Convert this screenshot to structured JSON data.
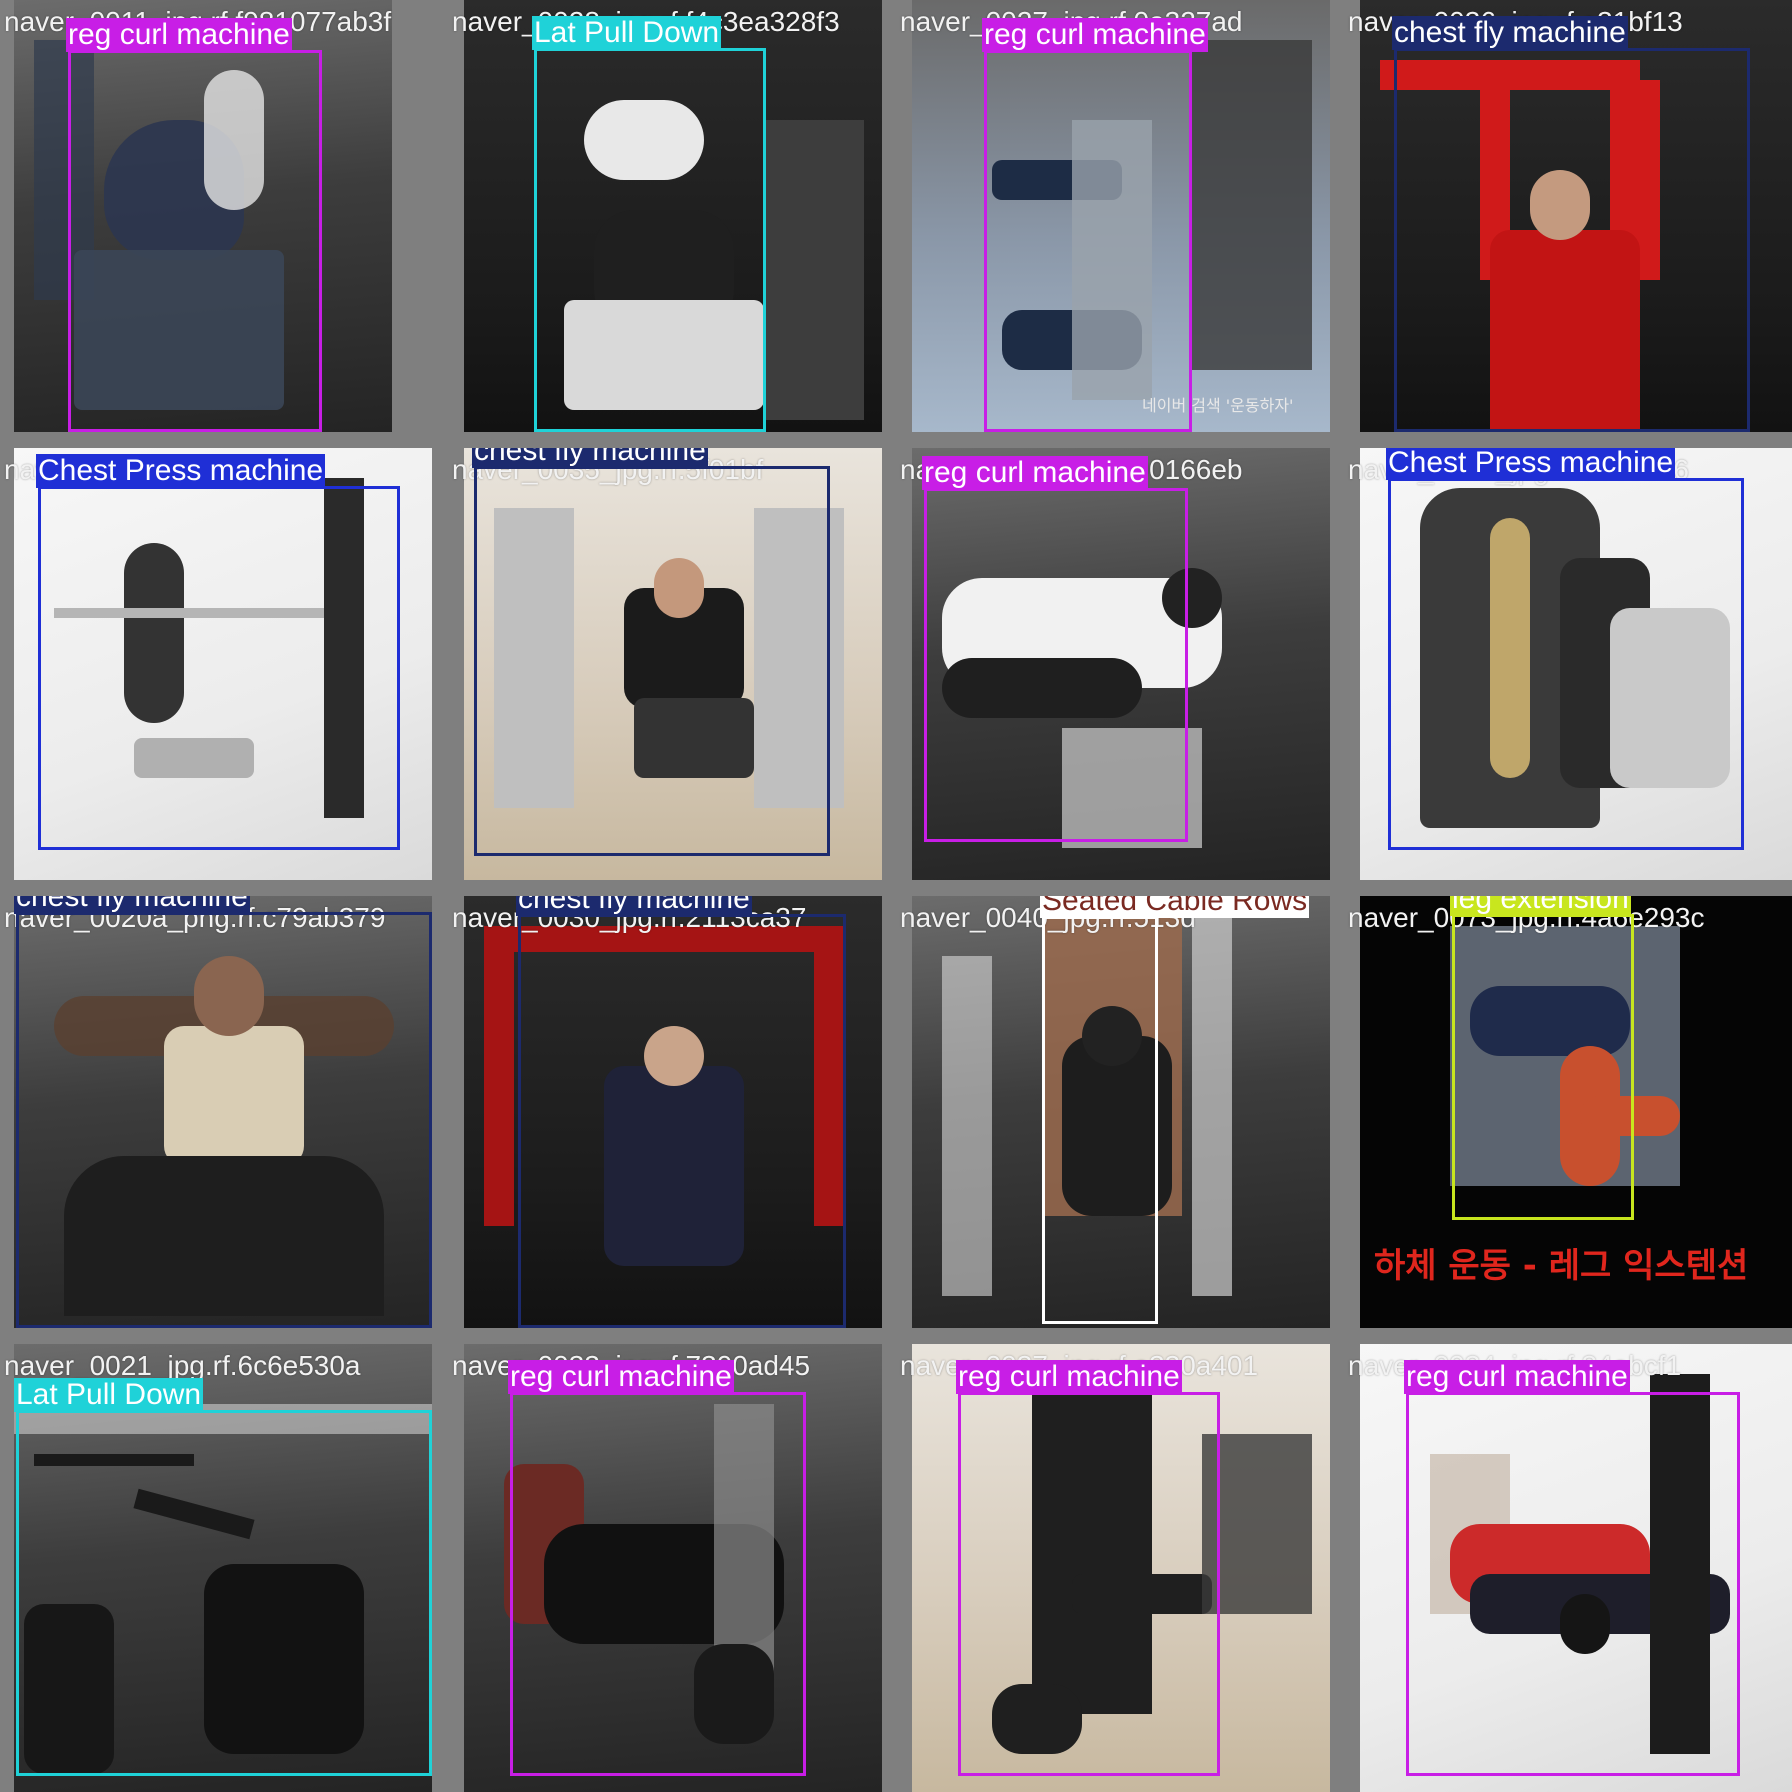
{
  "colors": {
    "reg_curl_machine": "#c81ee6",
    "lat_pull_down": "#1fd2d8",
    "chest_fly_machine": "#1c2a6e",
    "chest_press_machine": "#1f2fd6",
    "seated_cable_rows": "#ffffff",
    "leg_extension": "#c8e61e"
  },
  "tiles": [
    {
      "filename": "naver_0011_jpg.rf.f981077ab3f",
      "labels": [
        "reg curl machine"
      ]
    },
    {
      "filename": "naver_0028_jpg.rf.f4c3ea328f3",
      "labels": [
        "Lat Pull Down"
      ]
    },
    {
      "filename": "naver_0027_jpg.rf.0a327ad",
      "labels": [
        "reg curl machine"
      ]
    },
    {
      "filename": "naver_0036_jpg.rf.a31bf13",
      "labels": [
        "chest fly machine"
      ]
    },
    {
      "filename": "naver_0021835",
      "labels": [
        "Chest Press machine"
      ]
    },
    {
      "filename": "naver_0035_jpg.rf.5f01bf",
      "labels": [
        "chest fly machine"
      ]
    },
    {
      "filename": "naver_0029_jpg.rf.90166eb",
      "labels": [
        "reg curl machine"
      ]
    },
    {
      "filename": "naver_0020_jpg.rf.d965bc6",
      "labels": [
        "Chest Press machine"
      ]
    },
    {
      "filename": "naver_0020a_png.rf.c79ab379",
      "labels": [
        "chest fly machine"
      ]
    },
    {
      "filename": "naver_0030_jpg.rf.2113ca37",
      "labels": [
        "chest fly machine"
      ]
    },
    {
      "filename": "naver_0040_jpg.rf.513d",
      "labels": [
        "Seated Cable Rows"
      ]
    },
    {
      "filename": "naver_0073_jpg.rf.4a6e293c",
      "labels": [
        "leg extension"
      ]
    },
    {
      "filename": "naver_0021_jpg.rf.6c6e530a",
      "labels": [
        "Lat Pull Down"
      ]
    },
    {
      "filename": "naver_0033_jpg.rf.7300ad45",
      "labels": [
        "reg curl machine"
      ]
    },
    {
      "filename": "naver_0037_jpg.rf.a330a401",
      "labels": [
        "reg curl machine"
      ]
    },
    {
      "filename": "naver_0034_jpg.rf.84ebcf1",
      "labels": [
        "reg curl machine"
      ]
    }
  ],
  "overlays": {
    "tile3_watermark": "네이버 검색 '운동하자'",
    "tile12_caption": "하체 운동 - 레그 익스텐션"
  }
}
